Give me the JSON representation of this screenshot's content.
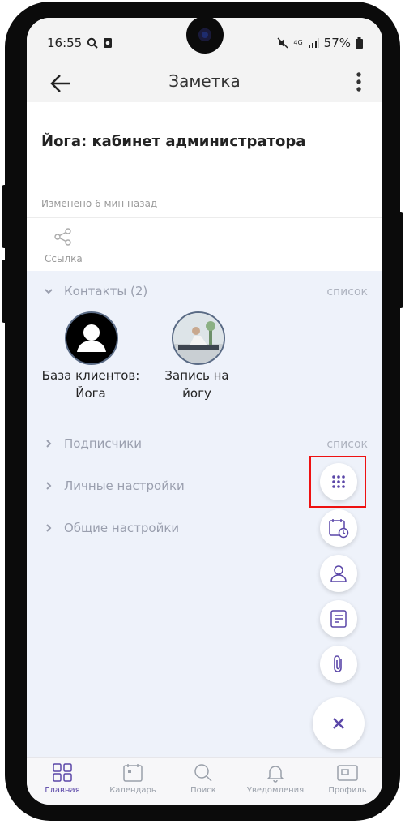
{
  "status_bar": {
    "time": "16:55",
    "battery": "57%",
    "network": "4G"
  },
  "app_bar": {
    "title": "Заметка"
  },
  "note": {
    "title": "Йога: кабинет администратора",
    "changed": "Изменено 6 мин назад",
    "link_label": "Ссылка"
  },
  "sections": {
    "contacts": {
      "label": "Контакты (2)",
      "action": "список"
    },
    "subscribers": {
      "label": "Подписчики",
      "action": "список"
    },
    "personal": {
      "label": "Личные настройки"
    },
    "general": {
      "label": "Общие настройки"
    }
  },
  "contacts": [
    {
      "line1": "База клиентов:",
      "line2": "Йога"
    },
    {
      "line1": "Запись на",
      "line2": "йогу"
    }
  ],
  "bottom_nav": {
    "home": "Главная",
    "calendar": "Календарь",
    "search": "Поиск",
    "notifications": "Уведомления",
    "profile": "Профиль"
  },
  "colors": {
    "accent": "#5a46a8",
    "highlight": "#ee1111",
    "lower_bg": "#eef2fa"
  }
}
